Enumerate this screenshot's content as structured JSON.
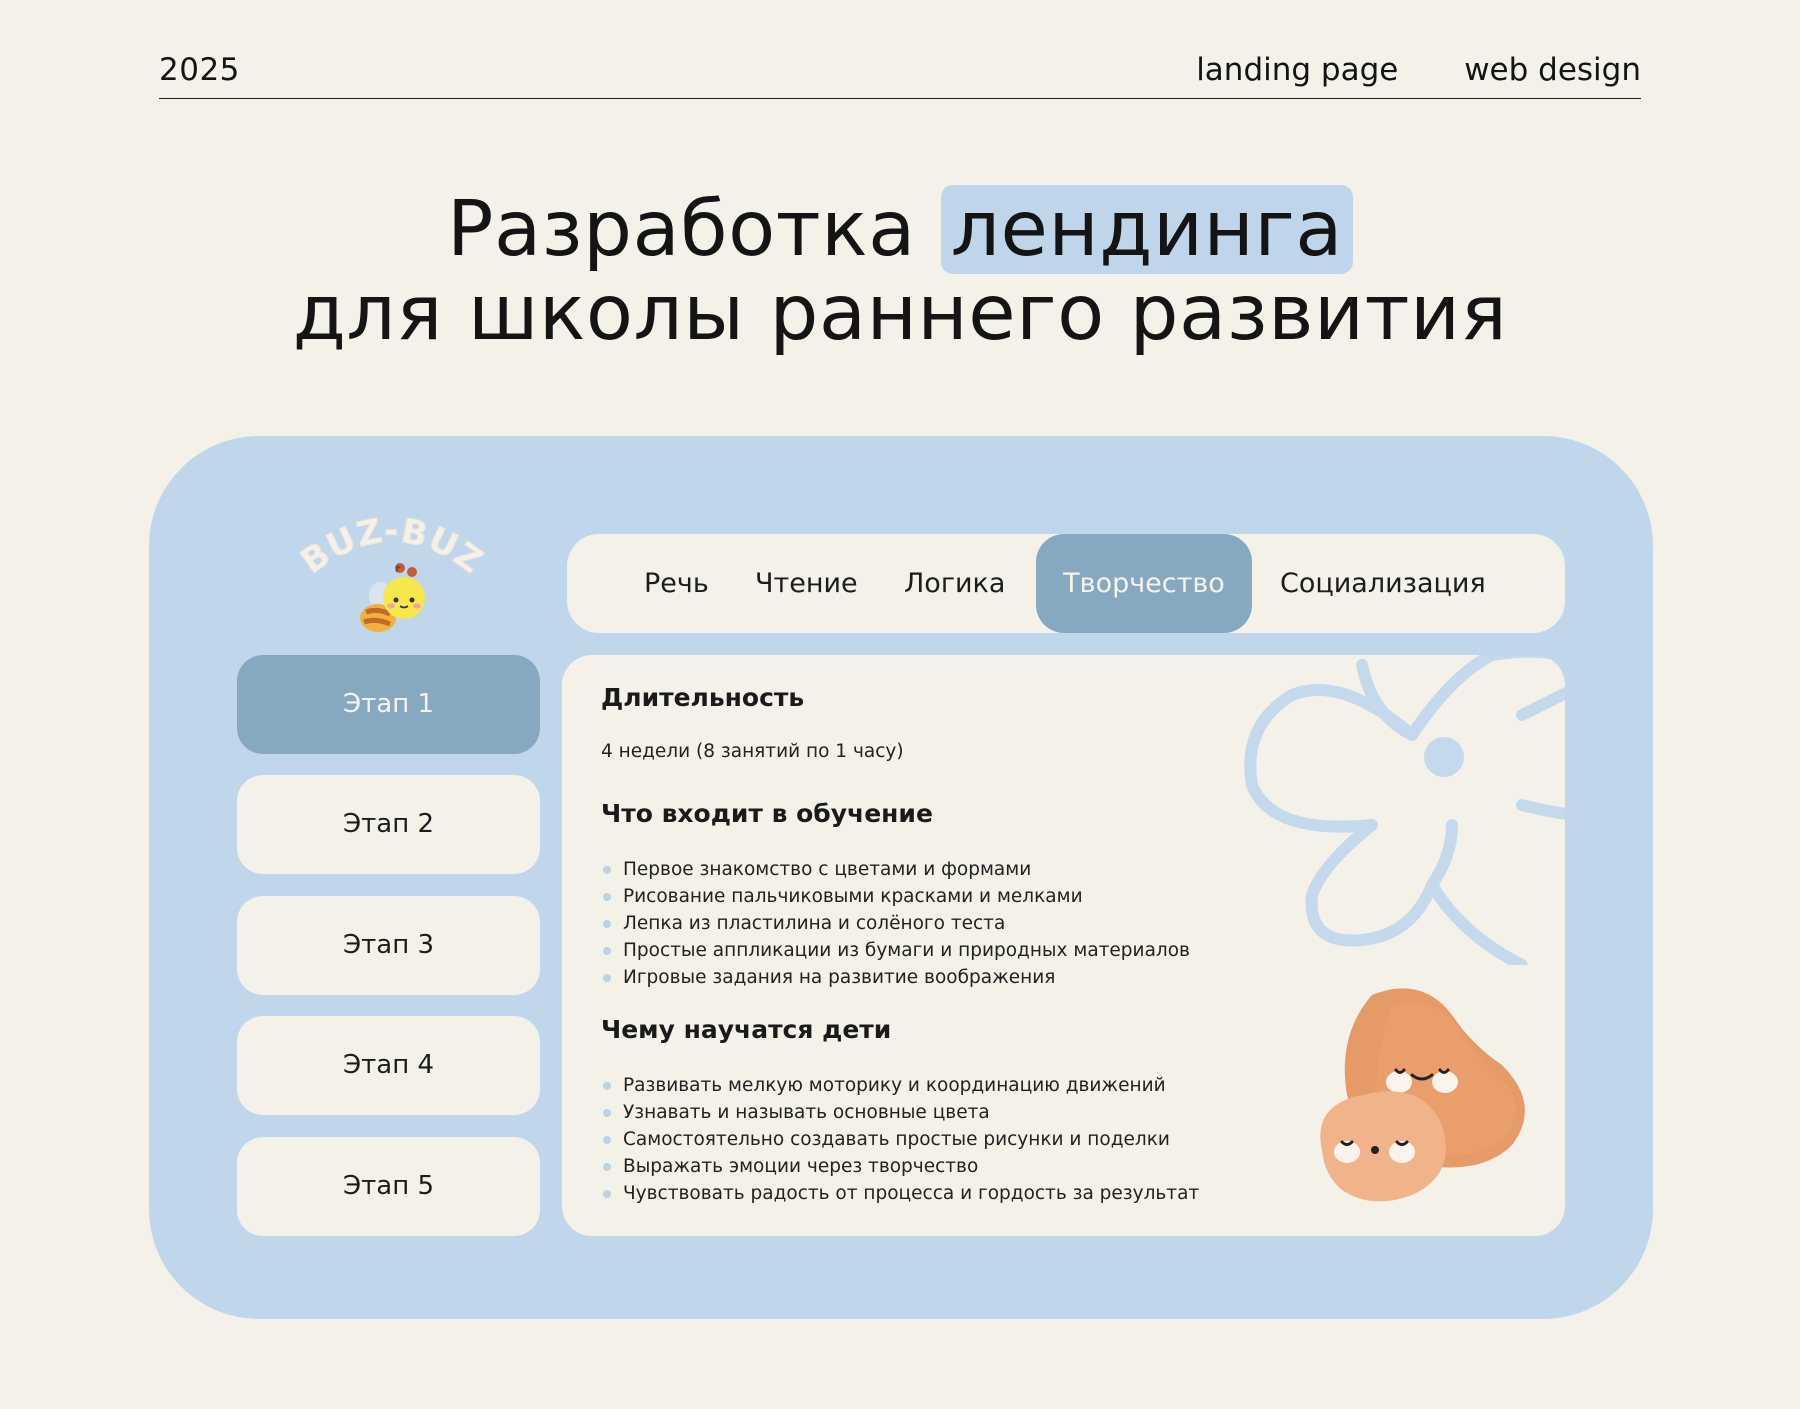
{
  "header": {
    "year": "2025",
    "tags": [
      "landing page",
      "web design"
    ]
  },
  "headline": {
    "line1_prefix": "Разработка",
    "line1_highlight": "лендинга",
    "line2": "для школы раннего развития"
  },
  "brand": {
    "logo_text": "BUZ-BUZ",
    "mascot_icon": "bee-icon"
  },
  "nav": {
    "tabs": [
      {
        "label": "Речь"
      },
      {
        "label": "Чтение"
      },
      {
        "label": "Логика"
      },
      {
        "label": "Творчество",
        "active": true
      },
      {
        "label": "Социализация"
      }
    ]
  },
  "stages": [
    {
      "label": "Этап 1",
      "active": true
    },
    {
      "label": "Этап 2"
    },
    {
      "label": "Этап 3"
    },
    {
      "label": "Этап 4"
    },
    {
      "label": "Этап 5"
    }
  ],
  "content": {
    "duration_title": "Длительность",
    "duration_text": "4 недели (8 занятий по 1 часу)",
    "includes_title": "Что входит в обучение",
    "includes": [
      "Первое знакомство с цветами и формами",
      "Рисование пальчиковыми красками и мелками",
      "Лепка из пластилина и солёного теста",
      "Простые аппликации из бумаги и природных материалов",
      "Игровые задания на развитие воображения"
    ],
    "outcomes_title": "Чему научатся дети",
    "outcomes": [
      "Развивать мелкую моторику и координацию движений",
      "Узнавать и называть основные цвета",
      "Самостоятельно создавать простые рисунки и поделки",
      "Выражать эмоции через творчество",
      "Чувствовать радость от процесса и гордость за результат"
    ]
  },
  "colors": {
    "background": "#f4f1e9",
    "panel": "#c0d7eb",
    "active": "#87a8c1",
    "blob_dark": "#e59a67",
    "blob_light": "#f1b38a"
  }
}
